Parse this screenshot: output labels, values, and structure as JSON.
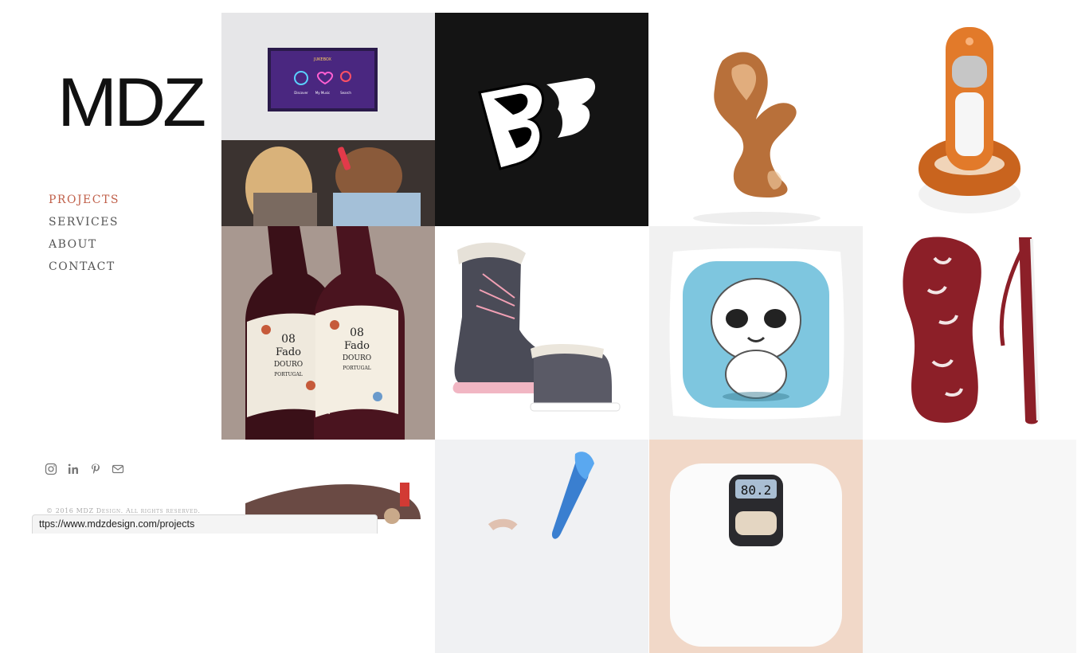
{
  "brand": {
    "logo_text": "MDZ"
  },
  "nav": {
    "items": [
      {
        "label": "PROJECTS",
        "active": true
      },
      {
        "label": "SERVICES",
        "active": false
      },
      {
        "label": "ABOUT",
        "active": false
      },
      {
        "label": "CONTACT",
        "active": false
      }
    ]
  },
  "social": [
    "instagram-icon",
    "linkedin-icon",
    "pinterest-icon",
    "email-icon"
  ],
  "footer": {
    "copyright": "© 2016 MDZ Design. All rights reserved."
  },
  "status_url": "ttps://www.mdzdesign.com/projects",
  "tv_screen": {
    "title": "JUKEBOX",
    "items": [
      "Discover",
      "My Music",
      "Search"
    ]
  },
  "wine_label": {
    "number": "08",
    "name": "Fado",
    "region": "DOURO",
    "country": "PORTUGAL"
  },
  "scale_display": "80.2",
  "accent_color": "#c0604a",
  "projects": [
    "project-jukebox-tv",
    "project-bb-logo",
    "project-bronze-sculpture",
    "project-cordless-phone",
    "project-fado-wine",
    "project-snow-boots",
    "project-cartoon-pillow",
    "project-flip-flop",
    "project-shoe",
    "project-toothbrush",
    "project-bathroom-scale",
    "project-empty"
  ]
}
